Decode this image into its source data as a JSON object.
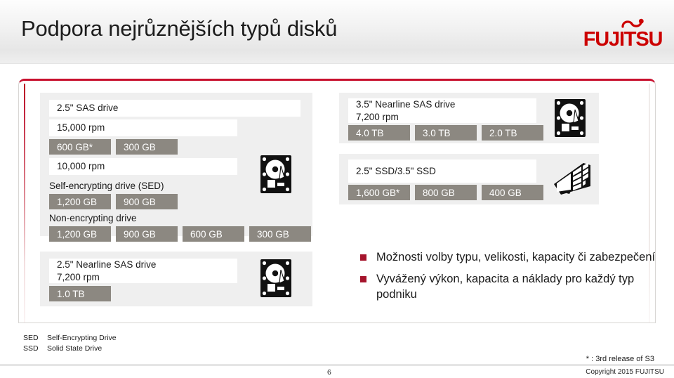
{
  "header": {
    "title": "Podpora nejrůznějších typů disků",
    "logo_text": "FUJITSU",
    "logo_icon": "fujitsu-infinity-mark",
    "brand_color": "#cc0000"
  },
  "accent": {
    "frame_top_border": "#c8102e",
    "bullet_square": "#a5142c",
    "chip_background": "#8c8881",
    "panel_background": "#efefef"
  },
  "panels": {
    "sas_25": {
      "title": "2.5\" SAS drive",
      "icon": "hard-disk-drive-icon",
      "rows": [
        {
          "label": "15,000 rpm",
          "type": "whitebar"
        },
        {
          "type": "chips",
          "chips": [
            "600 GB*",
            "300 GB"
          ]
        },
        {
          "label": "10,000 rpm",
          "type": "whitebar"
        },
        {
          "label": "Self-encrypting drive (SED)",
          "type": "plain"
        },
        {
          "type": "chips",
          "chips": [
            "1,200 GB",
            "900 GB"
          ]
        },
        {
          "label": "Non-encrypting drive",
          "type": "plain"
        },
        {
          "type": "chips",
          "chips": [
            "1,200 GB",
            "900 GB",
            "600 GB",
            "300 GB"
          ]
        }
      ]
    },
    "nearline_25": {
      "title": "2.5\" Nearline SAS drive\n7,200 rpm",
      "icon": "hard-disk-drive-icon",
      "chips": [
        "1.0 TB"
      ]
    },
    "nearline_35": {
      "title": "3.5\" Nearline SAS drive\n7,200 rpm",
      "icon": "hard-disk-drive-icon",
      "chips": [
        "4.0 TB",
        "3.0 TB",
        "2.0 TB"
      ]
    },
    "ssd": {
      "title": "2.5\" SSD/3.5\" SSD",
      "icon": "solid-state-drive-icon",
      "chips": [
        "1,600 GB*",
        "800 GB",
        "400 GB"
      ]
    }
  },
  "bullets": [
    "Možnosti volby typu, velikosti, kapacity či zabezpečení",
    "Vyvážený výkon, kapacita a náklady pro každý typ podniku"
  ],
  "footer": {
    "legend": [
      {
        "abbr": "SED",
        "meaning": "Self-Encrypting Drive"
      },
      {
        "abbr": "SSD",
        "meaning": "Solid State Drive"
      }
    ],
    "note": "* : 3rd release of S3",
    "page_number": "6",
    "copyright": "Copyright 2015 FUJITSU"
  }
}
